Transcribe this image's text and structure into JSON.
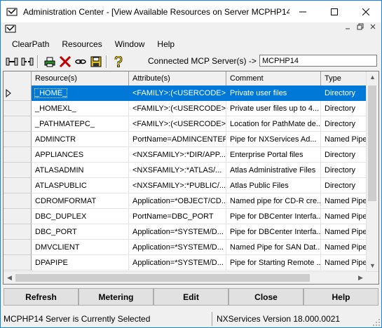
{
  "window": {
    "title": "Administration Center - [View Available Resources on Server MCPHP14]",
    "controls": {
      "minimize": "minimize-icon",
      "maximize": "maximize-icon",
      "close": "close-icon"
    }
  },
  "menu": {
    "items": [
      "ClearPath",
      "Resources",
      "Window",
      "Help"
    ]
  },
  "toolbar": {
    "icons": [
      "connect-icon",
      "disconnect-icon",
      "print-icon",
      "delete-icon",
      "link-icon",
      "save-icon",
      "help-icon"
    ],
    "server_label": "Connected MCP Server(s) ->",
    "server_value": "MCPHP14"
  },
  "grid": {
    "columns": [
      "",
      "Resource(s)",
      "Attribute(s)",
      "Comment",
      "Type"
    ],
    "rows": [
      {
        "resource": "_HOME_",
        "attribute": "<FAMILY>:(<USERCODE>)",
        "comment": "Private user files",
        "type": "Directory",
        "selected": true
      },
      {
        "resource": "_HOMEXL_",
        "attribute": "<FAMILY>:(<USERCODE>)",
        "comment": "Private user files up to 4...",
        "type": "Directory"
      },
      {
        "resource": "_PATHMATEPC_",
        "attribute": "<FAMILY>:(<USERCODE>)",
        "comment": "Location for PathMate de...",
        "type": "Directory"
      },
      {
        "resource": "ADMINCTR",
        "attribute": "PortName=ADMINCENTER",
        "comment": "Pipe for NXServices Ad...",
        "type": "Named Pipe"
      },
      {
        "resource": "APPLIANCES",
        "attribute": "<NXSFAMILY>:*DIR/APP...",
        "comment": "Enterprise Portal files",
        "type": "Directory"
      },
      {
        "resource": "ATLASADMIN",
        "attribute": "<NXSFAMILY>:*ATLAS/...",
        "comment": "Atlas Administrative Files",
        "type": "Directory"
      },
      {
        "resource": "ATLASPUBLIC",
        "attribute": "<NXSFAMILY>:*PUBLIC/...",
        "comment": "Atlas Public Files",
        "type": "Directory"
      },
      {
        "resource": "CDROMFORMAT",
        "attribute": "Application=*OBJECT/CD...",
        "comment": "Named pipe for CD-R cre...",
        "type": "Named Pipe"
      },
      {
        "resource": "DBC_DUPLEX",
        "attribute": "PortName=DBC_PORT",
        "comment": "Pipe for DBCenter Interfa...",
        "type": "Named Pipe"
      },
      {
        "resource": "DBC_PORT",
        "attribute": "Application=*SYSTEM/D...",
        "comment": "Pipe for DBCenter Interfa...",
        "type": "Named Pipe"
      },
      {
        "resource": "DMVCLIENT",
        "attribute": "Application=*SYSTEM/D...",
        "comment": "Named Pipe for SAN Dat...",
        "type": "Named Pipe"
      },
      {
        "resource": "DPAPIPE",
        "attribute": "Application=*SYSTEM/D...",
        "comment": "Pipe for Starting Remote ...",
        "type": "Named Pipe"
      }
    ]
  },
  "buttons": [
    "Refresh",
    "Metering",
    "Edit",
    "Close",
    "Help"
  ],
  "status": {
    "left": "MCPHP14 Server is Currently Selected",
    "right": "NXServices Version 18.000.0021"
  }
}
